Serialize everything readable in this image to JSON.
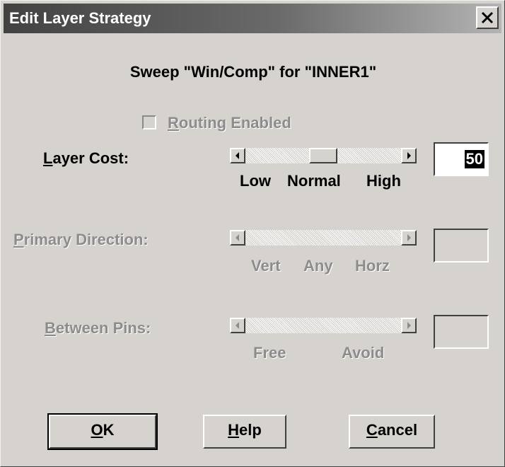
{
  "window": {
    "title": "Edit Layer Strategy"
  },
  "heading": "Sweep \"Win/Comp\" for \"INNER1\"",
  "routing_enabled": {
    "label_prefix": "",
    "mnemonic": "R",
    "label_rest": "outing Enabled",
    "checked": false,
    "enabled": false
  },
  "layer_cost": {
    "mnemonic": "L",
    "label_rest": "ayer Cost:",
    "ticks": [
      "Low",
      "Normal",
      "High"
    ],
    "value": "50",
    "enabled": true
  },
  "primary_direction": {
    "mnemonic": "P",
    "label_rest": "rimary Direction:",
    "ticks": [
      "Vert",
      "Any",
      "Horz"
    ],
    "value": "",
    "enabled": false
  },
  "between_pins": {
    "mnemonic": "B",
    "label_rest": "etween Pins:",
    "ticks": [
      "Free",
      "Avoid"
    ],
    "value": "",
    "enabled": false
  },
  "buttons": {
    "ok": {
      "mnemonic": "O",
      "rest": "K"
    },
    "help": {
      "mnemonic": "H",
      "rest": "elp"
    },
    "cancel": {
      "mnemonic": "C",
      "rest": "ancel"
    }
  },
  "icons": {
    "close": "close-icon",
    "left_arrow": "left-arrow-icon",
    "right_arrow": "right-arrow-icon"
  }
}
